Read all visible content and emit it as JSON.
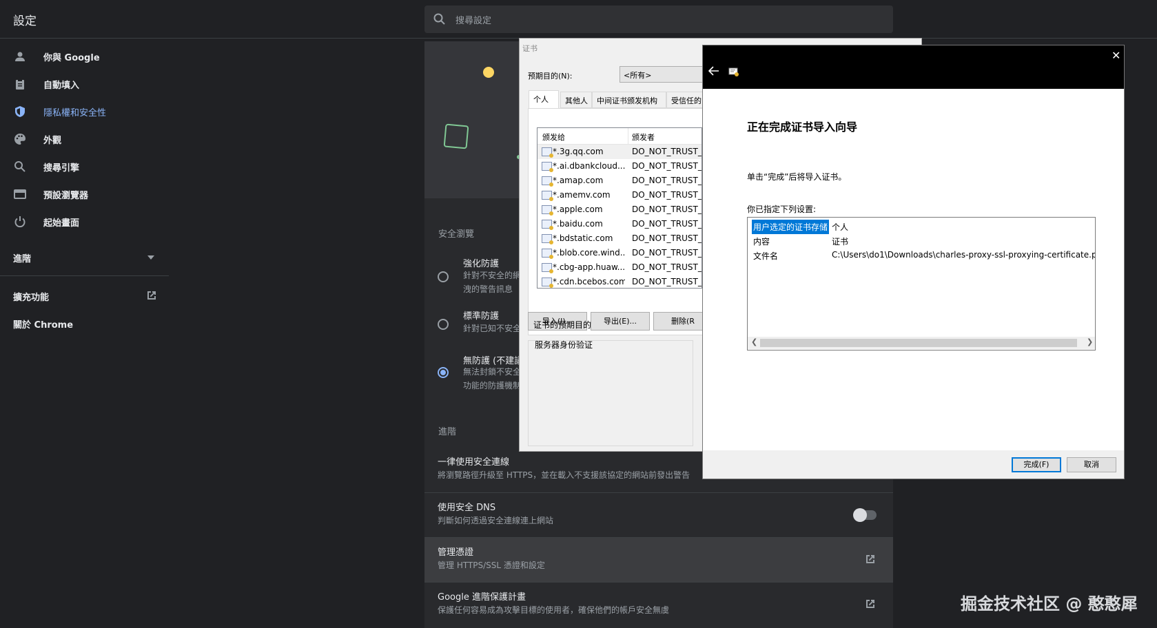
{
  "header": {
    "title": "設定",
    "search_placeholder": "搜尋設定"
  },
  "sidebar": {
    "items": [
      {
        "label": "你與 Google",
        "icon": "person-icon"
      },
      {
        "label": "自動填入",
        "icon": "clipboard-icon"
      },
      {
        "label": "隱私權和安全性",
        "icon": "shield-icon",
        "active": true
      },
      {
        "label": "外觀",
        "icon": "palette-icon"
      },
      {
        "label": "搜尋引擎",
        "icon": "search-icon"
      },
      {
        "label": "預設瀏覽器",
        "icon": "browser-icon"
      },
      {
        "label": "起始畫面",
        "icon": "power-icon"
      }
    ],
    "advanced": "進階",
    "extensions": "擴充功能",
    "about": "關於 Chrome"
  },
  "main": {
    "safe_browsing_label": "安全瀏覽",
    "options": [
      {
        "title": "強化防護",
        "desc1": "針對不安全的網",
        "desc2": "洩的警告訊息",
        "selected": false
      },
      {
        "title": "標準防護",
        "desc1": "針對已知不安全",
        "desc2": "",
        "selected": false
      },
      {
        "title": "無防護 (不建議",
        "desc1": "無法封鎖不安全",
        "desc2": "功能的防護機制",
        "selected": true
      }
    ],
    "advanced_label": "進階",
    "rows": [
      {
        "title": "一律使用安全連線",
        "desc": "將瀏覽路徑升級至 HTTPS，並在載入不支援該協定的網站前發出警告"
      },
      {
        "title": "使用安全 DNS",
        "desc": "判斷如何透過安全連線連上網站",
        "toggle": false
      },
      {
        "title": "管理憑證",
        "desc": "管理 HTTPS/SSL 憑證和設定"
      },
      {
        "title": "Google 進階保護計畫",
        "desc": "保護任何容易成為攻擊目標的使用者，確保他們的帳戶安全無虞"
      }
    ]
  },
  "cert_dialog": {
    "title": "证书",
    "purpose_label": "预期目的(N):",
    "purpose_value": "<所有>",
    "tabs": [
      "个人",
      "其他人",
      "中间证书颁发机构",
      "受信任的"
    ],
    "columns": [
      "颁发给",
      "颁发者"
    ],
    "rows": [
      {
        "to": "*.3g.qq.com",
        "by": "DO_NOT_TRUST_"
      },
      {
        "to": "*.ai.dbankcloud....",
        "by": "DO_NOT_TRUST_"
      },
      {
        "to": "*.amap.com",
        "by": "DO_NOT_TRUST_"
      },
      {
        "to": "*.amemv.com",
        "by": "DO_NOT_TRUST_"
      },
      {
        "to": "*.apple.com",
        "by": "DO_NOT_TRUST_"
      },
      {
        "to": "*.baidu.com",
        "by": "DO_NOT_TRUST_"
      },
      {
        "to": "*.bdstatic.com",
        "by": "DO_NOT_TRUST_"
      },
      {
        "to": "*.blob.core.wind...",
        "by": "DO_NOT_TRUST_"
      },
      {
        "to": "*.cbg-app.huaw...",
        "by": "DO_NOT_TRUST_"
      },
      {
        "to": "*.cdn.bcebos.com",
        "by": "DO_NOT_TRUST_"
      }
    ],
    "import_btn": "导入(I)...",
    "export_btn": "导出(E)...",
    "delete_btn": "删除(R",
    "purposes_label": "证书的预期目的",
    "purposes_value": "服务器身份验证"
  },
  "wizard": {
    "close": "✕",
    "heading": "正在完成证书导入向导",
    "instruction": "单击“完成”后将导入证书。",
    "summary_label": "你已指定下列设置:",
    "summary": [
      {
        "key": "用户选定的证书存储",
        "value": "个人",
        "selected": true
      },
      {
        "key": "内容",
        "value": "证书",
        "selected": false
      },
      {
        "key": "文件名",
        "value": "C:\\Users\\do1\\Downloads\\charles-proxy-ssl-proxying-certificate.p",
        "selected": false
      }
    ],
    "finish_btn": "完成(F)",
    "cancel_btn": "取消"
  },
  "watermark": "掘金技术社区 @ 憨憨犀",
  "colors": {
    "accent": "#8ab4f8",
    "background": "#202124",
    "selection": "#0078d7"
  }
}
